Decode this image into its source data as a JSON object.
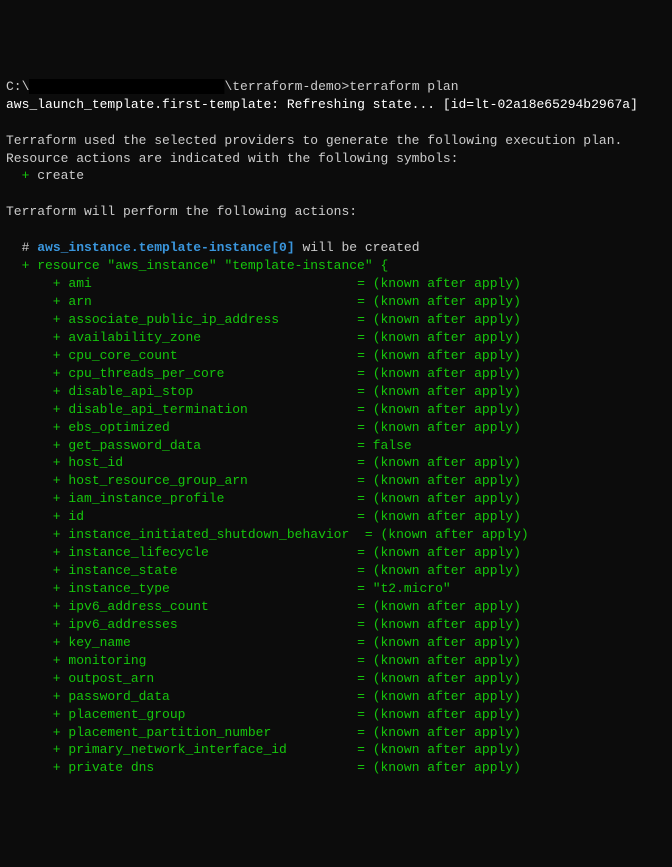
{
  "prompt": {
    "drive": "C:\\",
    "path_suffix": "\\terraform-demo>",
    "command": "terraform plan"
  },
  "refresh_line": {
    "resource": "aws_launch_template.first-template",
    "text": ": Refreshing state... [id=lt-02a18e65294b2967a]"
  },
  "intro": {
    "line1": "Terraform used the selected providers to generate the following execution plan.",
    "line2": "Resource actions are indicated with the following symbols:",
    "create_symbol": "  +",
    "create_label": " create"
  },
  "actions_header": "Terraform will perform the following actions:",
  "resource_block": {
    "comment_prefix": "  # ",
    "comment_address": "aws_instance.template-instance[0]",
    "comment_suffix": " will be created",
    "open_plus": "  +",
    "open_text": " resource \"aws_instance\" \"template-instance\" {",
    "attributes": [
      {
        "name": "ami",
        "value": "(known after apply)"
      },
      {
        "name": "arn",
        "value": "(known after apply)"
      },
      {
        "name": "associate_public_ip_address",
        "value": "(known after apply)"
      },
      {
        "name": "availability_zone",
        "value": "(known after apply)"
      },
      {
        "name": "cpu_core_count",
        "value": "(known after apply)"
      },
      {
        "name": "cpu_threads_per_core",
        "value": "(known after apply)"
      },
      {
        "name": "disable_api_stop",
        "value": "(known after apply)"
      },
      {
        "name": "disable_api_termination",
        "value": "(known after apply)"
      },
      {
        "name": "ebs_optimized",
        "value": "(known after apply)"
      },
      {
        "name": "get_password_data",
        "value": "false"
      },
      {
        "name": "host_id",
        "value": "(known after apply)"
      },
      {
        "name": "host_resource_group_arn",
        "value": "(known after apply)"
      },
      {
        "name": "iam_instance_profile",
        "value": "(known after apply)"
      },
      {
        "name": "id",
        "value": "(known after apply)"
      },
      {
        "name": "instance_initiated_shutdown_behavior",
        "value": "(known after apply)"
      },
      {
        "name": "instance_lifecycle",
        "value": "(known after apply)"
      },
      {
        "name": "instance_state",
        "value": "(known after apply)"
      },
      {
        "name": "instance_type",
        "value": "\"t2.micro\""
      },
      {
        "name": "ipv6_address_count",
        "value": "(known after apply)"
      },
      {
        "name": "ipv6_addresses",
        "value": "(known after apply)"
      },
      {
        "name": "key_name",
        "value": "(known after apply)"
      },
      {
        "name": "monitoring",
        "value": "(known after apply)"
      },
      {
        "name": "outpost_arn",
        "value": "(known after apply)"
      },
      {
        "name": "password_data",
        "value": "(known after apply)"
      },
      {
        "name": "placement_group",
        "value": "(known after apply)"
      },
      {
        "name": "placement_partition_number",
        "value": "(known after apply)"
      },
      {
        "name": "primary_network_interface_id",
        "value": "(known after apply)"
      },
      {
        "name": "private dns",
        "value": "(known after apply)"
      }
    ],
    "name_col_width": 36
  }
}
